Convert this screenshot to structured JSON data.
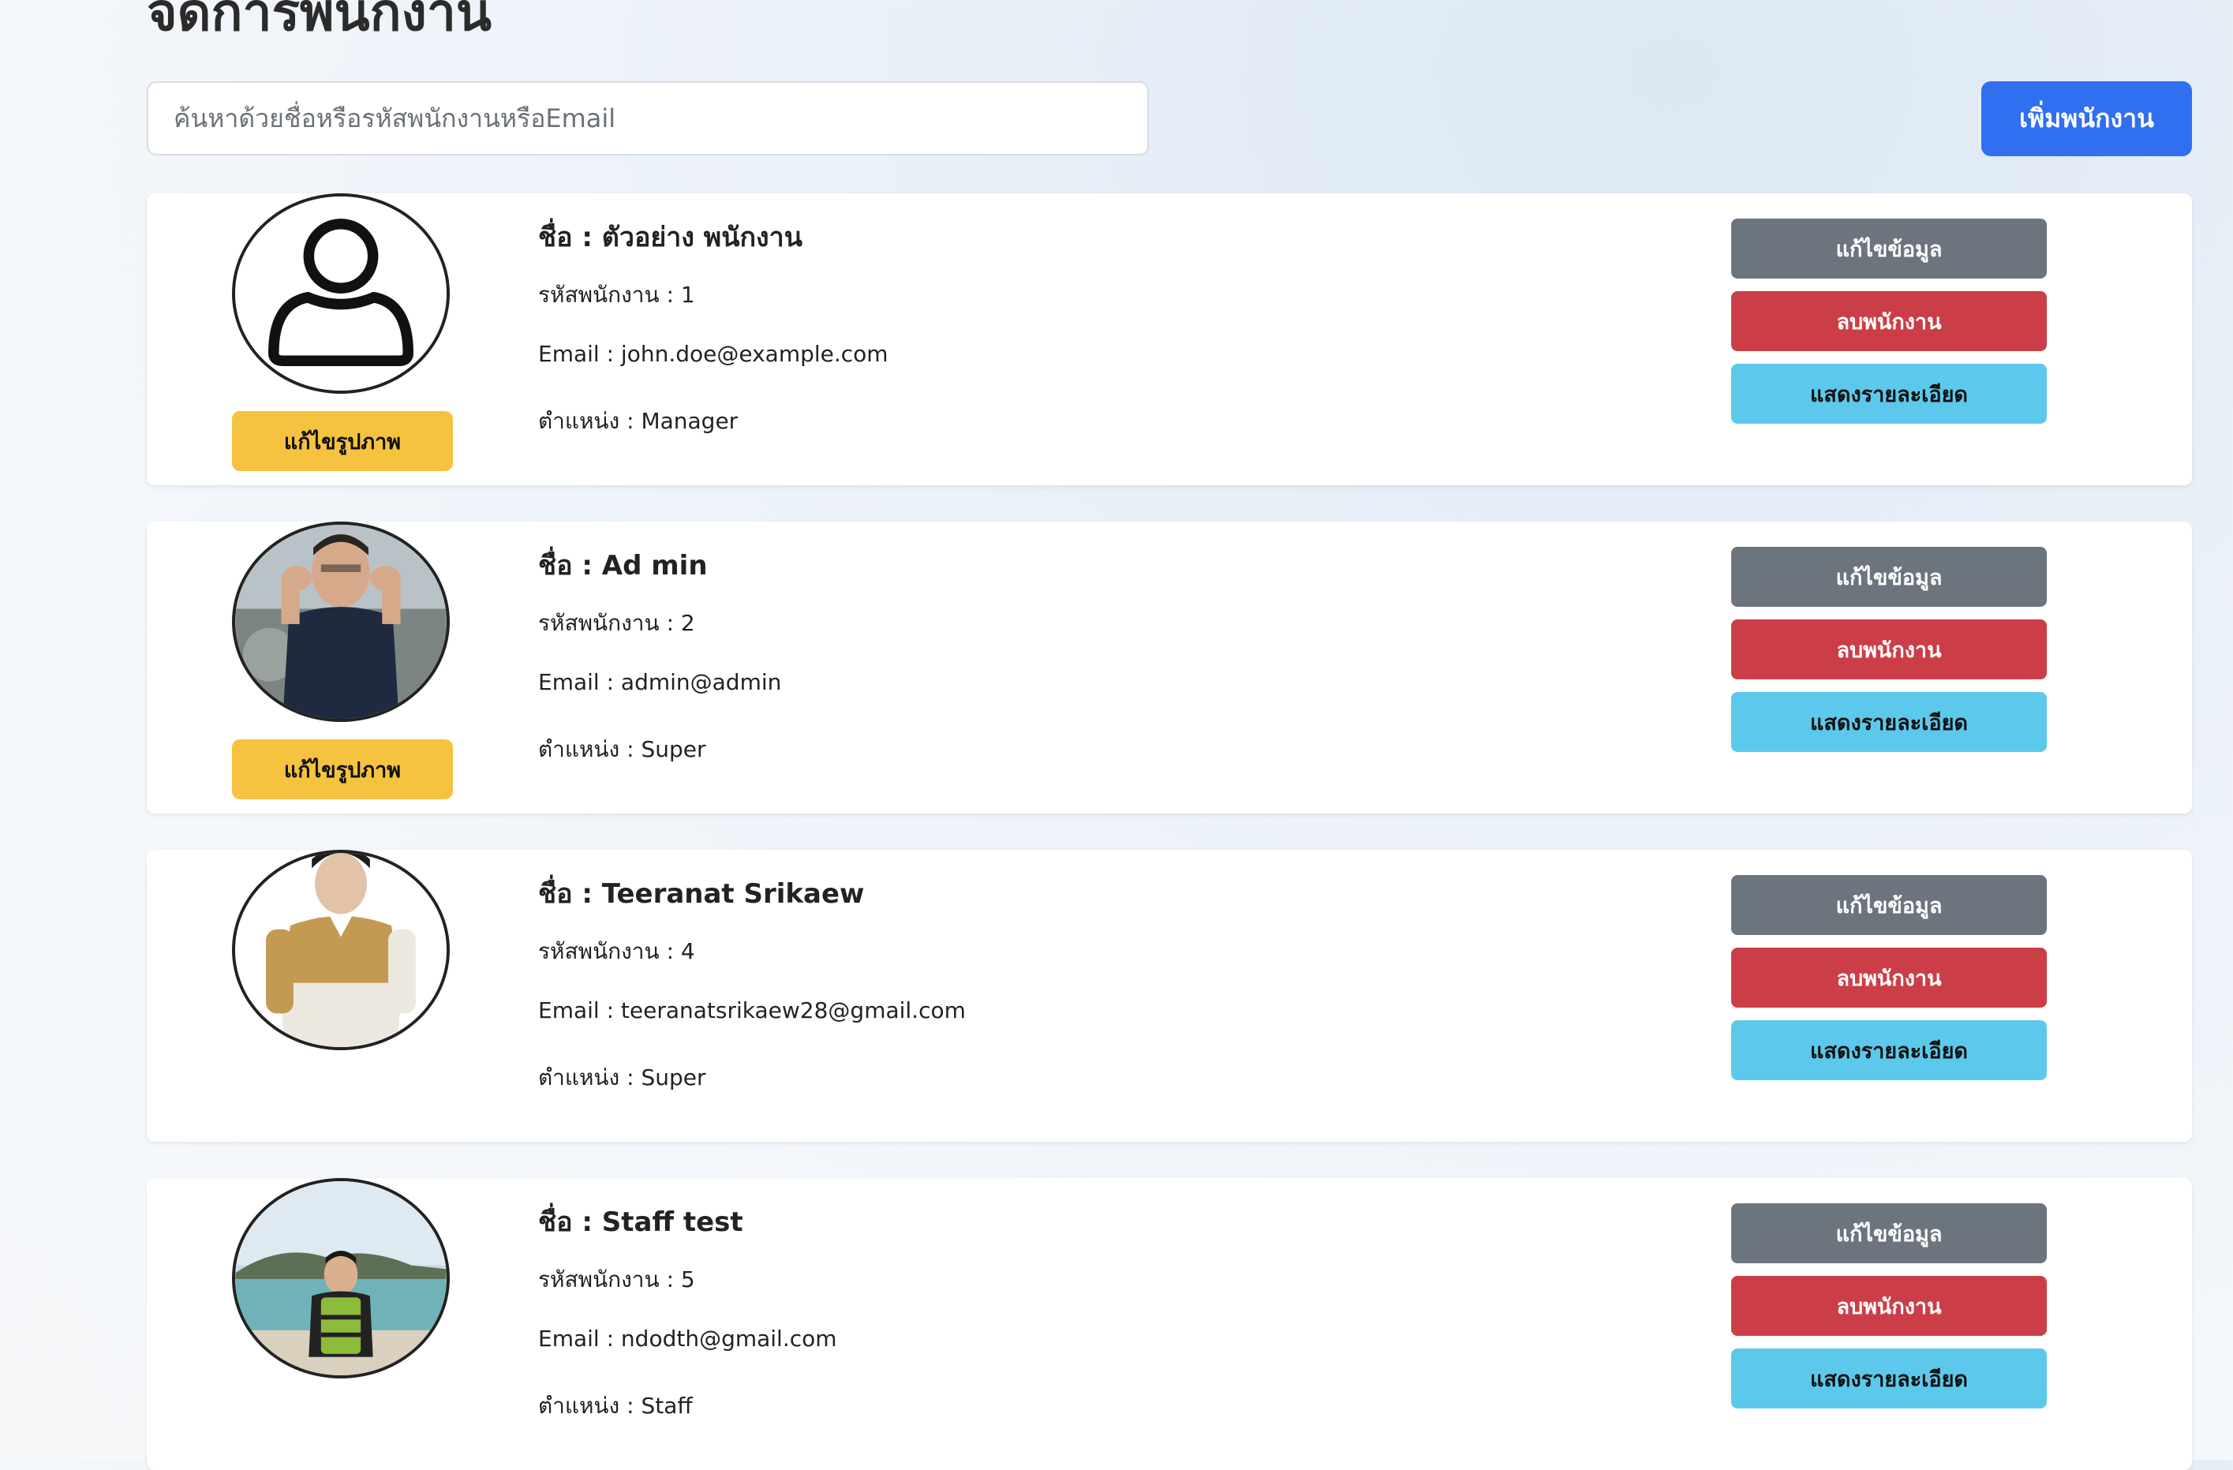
{
  "page": {
    "title": "จัดการพนักงาน",
    "search_placeholder": "ค้นหาด้วยชื่อหรือรหัสพนักงานหรือEmail",
    "add_button": "เพิ่มพนักงาน"
  },
  "labels": {
    "edit_image": "แก้ไขรูปภาพ",
    "edit_info": "แก้ไขข้อมูล",
    "delete": "ลบพนักงาน",
    "details": "แสดงรายละเอียด"
  },
  "employees": [
    {
      "name": "ชื่อ : ตัวอย่าง พนักงาน",
      "code": "รหัสพนักงาน : 1",
      "email": "Email : john.doe@example.com",
      "position": "ตำแหน่ง : Manager",
      "avatar": "default-user-icon",
      "has_edit_image": true
    },
    {
      "name": "ชื่อ : Ad min",
      "code": "รหัสพนักงาน : 2",
      "email": "Email : admin@admin",
      "position": "ตำแหน่ง : Super",
      "avatar": "photo-man-tank-top",
      "has_edit_image": true
    },
    {
      "name": "ชื่อ : Teeranat Srikaew",
      "code": "รหัสพนักงาน : 4",
      "email": "Email : teeranatsrikaew28@gmail.com",
      "position": "ตำแหน่ง : Super",
      "avatar": "photo-man-polo-shirt",
      "has_edit_image": false
    },
    {
      "name": "ชื่อ : Staff test",
      "code": "รหัสพนักงาน : 5",
      "email": "Email : ndodth@gmail.com",
      "position": "ตำแหน่ง : Staff",
      "avatar": "photo-beach-life-jacket",
      "has_edit_image": false
    }
  ],
  "colors": {
    "primary": "#2f6ff0",
    "edit_image": "#f5c33f",
    "edit_info": "#6c757d",
    "delete": "#cc3e47",
    "details": "#5cc9ec"
  }
}
